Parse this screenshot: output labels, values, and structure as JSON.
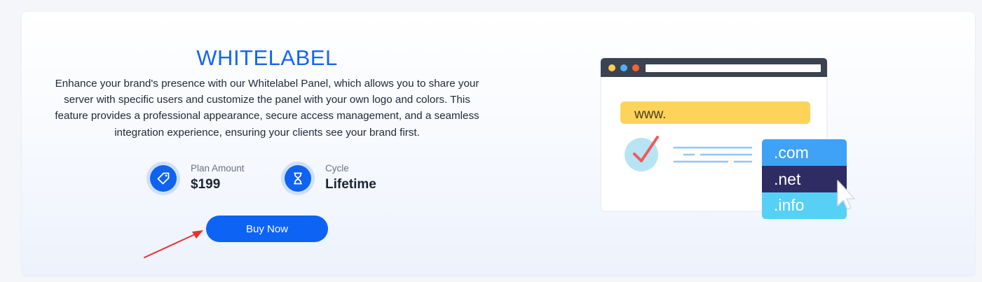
{
  "plan": {
    "title": "WHITELABEL",
    "description": "Enhance your brand's presence with our Whitelabel Panel, which allows you to share your server with specific users and customize the panel with your own logo and colors. This feature provides a professional appearance, secure access management, and a seamless integration experience, ensuring your clients see your brand first.",
    "stats": {
      "amount": {
        "label": "Plan Amount",
        "value": "$199",
        "icon": "price-tag-icon"
      },
      "cycle": {
        "label": "Cycle",
        "value": "Lifetime",
        "icon": "hourglass-icon"
      }
    },
    "buy_label": "Buy Now"
  },
  "illustration": {
    "url_text": "www.",
    "domains": [
      ".com",
      ".net",
      ".info"
    ]
  },
  "colors": {
    "accent": "#0d63f3",
    "title": "#1565f0",
    "url_bar": "#fdd35a",
    "domain_com": "#3fa2f7",
    "domain_net": "#2f2c63",
    "domain_info": "#56d0f5"
  }
}
